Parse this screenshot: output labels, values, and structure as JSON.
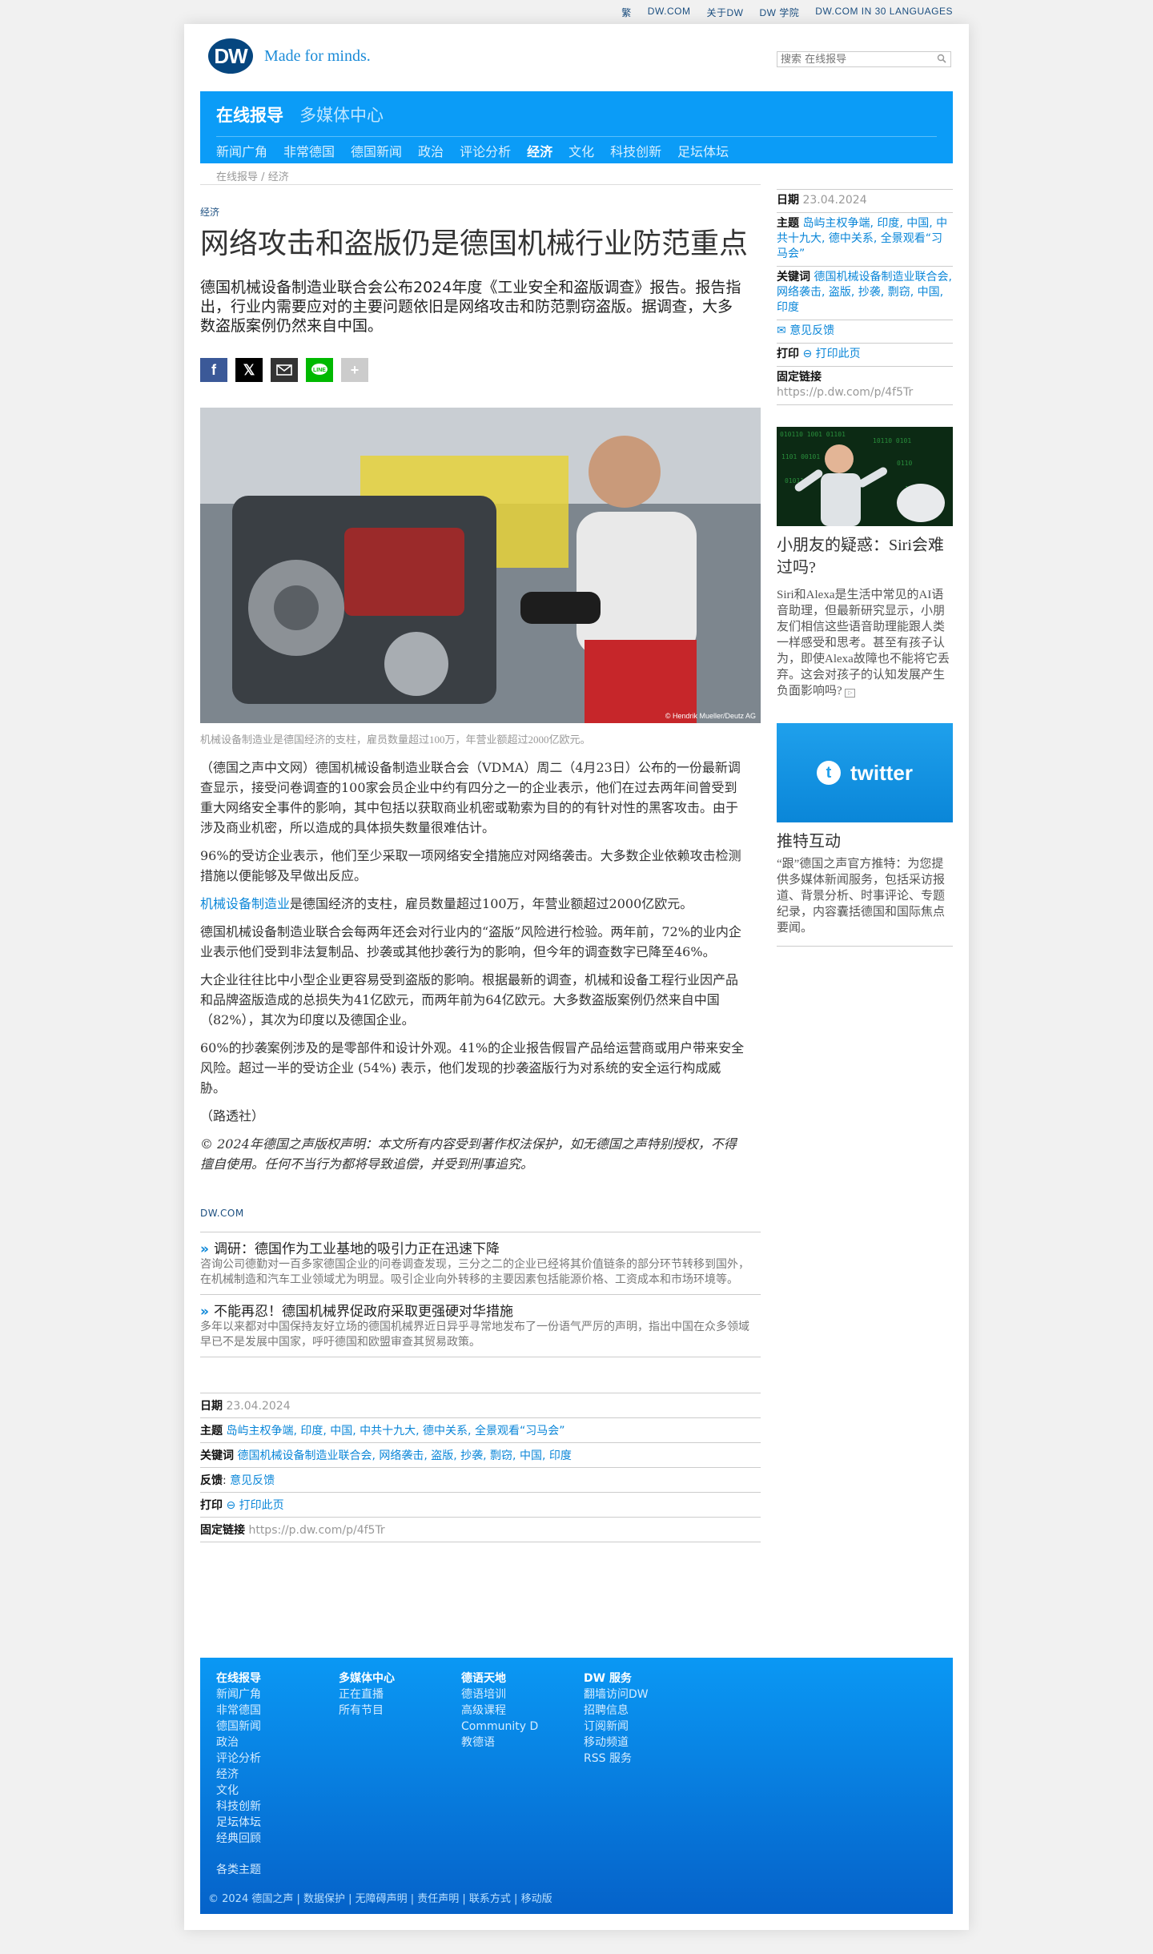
{
  "topbar": [
    "繁",
    "DW.COM",
    "关于DW",
    "DW 学院",
    "DW.COM IN 30 LANGUAGES"
  ],
  "header": {
    "logo": "DW",
    "tagline": "Made for minds.",
    "search_placeholder": "搜索 在线报导"
  },
  "nav": {
    "primary_active": "在线报导",
    "primary_other": "多媒体中心",
    "secondary": [
      "新闻广角",
      "非常德国",
      "德国新闻",
      "政治",
      "评论分析",
      "经济",
      "文化",
      "科技创新",
      "足坛体坛"
    ],
    "selected": "经济"
  },
  "breadcrumb": {
    "root": "在线报导",
    "sep": "/",
    "current": "经济"
  },
  "article": {
    "kicker": "经济",
    "title": "网络攻击和盗版仍是德国机械行业防范重点",
    "lead": "德国机械设备制造业联合会公布2024年度《工业安全和盗版调查》报告。报告指出，行业内需要应对的主要问题依旧是网络攻击和防范剽窃盗版。据调查，大多数盗版案例仍然来自中国。",
    "image_credit": "© Hendrik Mueller/Deutz AG",
    "caption": "机械设备制造业是德国经济的支柱，雇员数量超过100万，年营业额超过2000亿欧元。",
    "p1": "（德国之声中文网）德国机械设备制造业联合会（VDMA）周二（4月23日）公布的一份最新调查显示，接受问卷调查的100家会员企业中约有四分之一的企业表示，他们在过去两年间曾受到重大网络安全事件的影响，其中包括以获取商业机密或勒索为目的的有针对性的黑客攻击。由于涉及商业机密，所以造成的具体损失数量很难估计。",
    "p2": "96%的受访企业表示，他们至少采取一项网络安全措施应对网络袭击。大多数企业依赖攻击检测措施以便能够及早做出反应。",
    "p3_link": "机械设备制造业",
    "p3_rest": "是德国经济的支柱，雇员数量超过100万，年营业额超过2000亿欧元。",
    "p4": "德国机械设备制造业联合会每两年还会对行业内的“盗版”风险进行检验。两年前，72%的业内企业表示他们受到非法复制品、抄袭或其他抄袭行为的影响，但今年的调查数字已降至46%。",
    "p5": "大企业往往比中小型企业更容易受到盗版的影响。根据最新的调查，机械和设备工程行业因产品和品牌盗版造成的总损失为41亿欧元，而两年前为64亿欧元。大多数盗版案例仍然来自中国（82%），其次为印度以及德国企业。",
    "p6": "60%的抄袭案例涉及的是零部件和设计外观。41%的企业报告假冒产品给运营商或用户带来安全风险。超过一半的受访企业 (54%) 表示，他们发现的抄袭盗版行为对系统的安全运行构成威胁。",
    "p7": "（路透社）",
    "copyright": "© 2024年德国之声版权声明：本文所有内容受到著作权法保护，如无德国之声特别授权，不得擅自使用。任何不当行为都将导致追偿，并受到刑事追究。"
  },
  "related": {
    "heading": "DW.COM",
    "items": [
      {
        "title": "调研：德国作为工业基地的吸引力正在迅速下降",
        "desc": "咨询公司德勤对一百多家德国企业的问卷调查发现，三分之二的企业已经将其价值链条的部分环节转移到国外，在机械制造和汽车工业领域尤为明显。吸引企业向外转移的主要因素包括能源价格、工资成本和市场环境等。"
      },
      {
        "title": "不能再忍！德国机械界促政府采取更强硬对华措施",
        "desc": "多年以来都对中国保持友好立场的德国机械界近日异乎寻常地发布了一份语气严厉的声明，指出中国在众多领域早已不是发展中国家，呼吁德国和欧盟审查其贸易政策。"
      }
    ]
  },
  "meta": {
    "date_label": "日期",
    "date": "23.04.2024",
    "topics_label": "主题",
    "topics": "岛屿主权争端, 印度, 中国, 中共十九大, 德中关系, 全景观看“习马会”",
    "keywords_label": "关键词",
    "keywords": "德国机械设备制造业联合会, 网络袭击, 盗版, 抄袭, 剽窃, 中国, 印度",
    "feedback_label": "反馈",
    "feedback": "意见反馈",
    "print_label": "打印",
    "print": "打印此页",
    "permalink_label": "固定链接",
    "permalink": "https://p.dw.com/p/4f5Tr"
  },
  "sidebar": {
    "topics": "岛屿主权争端, 印度, 中国, 中共十九大, 德中关系, 全景观看“习马会”",
    "keywords": "德国机械设备制造业联合会, 网络袭击, 盗版, 抄袭, 剽窃, 中国, 印度",
    "feedback": "意见反馈",
    "teaser_title": "小朋友的疑惑：Siri会难过吗?",
    "teaser_text": "Siri和Alexa是生活中常见的AI语音助理，但最新研究显示，小朋友们相信这些语音助理能跟人类一样感受和思考。甚至有孩子认为，即使Alexa故障也不能将它丢弃。这会对孩子的认知发展产生负面影响吗?",
    "twitter_word": "twitter",
    "twitter_title": "推特互动",
    "twitter_text": "“跟”德国之声官方推特：为您提供多媒体新闻服务，包括采访报道、背景分析、时事评论、专题纪录，内容囊括德国和国际焦点要闻。"
  },
  "footer": {
    "col1": {
      "h": "在线报导",
      "items": [
        "新闻广角",
        "非常德国",
        "德国新闻",
        "政治",
        "评论分析",
        "经济",
        "文化",
        "科技创新",
        "足坛体坛",
        "经典回顾"
      ]
    },
    "col2": {
      "h": "多媒体中心",
      "items": [
        "正在直播",
        "所有节目"
      ]
    },
    "col3": {
      "h": "德语天地",
      "items": [
        "德语培训",
        "高级课程",
        "Community D",
        "教德语"
      ]
    },
    "col4": {
      "h": "DW 服务",
      "items": [
        "翻墙访问DW",
        "招聘信息",
        "订阅新闻",
        "移动频道",
        "RSS 服务"
      ]
    },
    "topics": "各类主题",
    "copyright": "© 2024 德国之声 | 数据保护 | 无障碍声明 | 责任声明 | 联系方式 | 移动版"
  }
}
